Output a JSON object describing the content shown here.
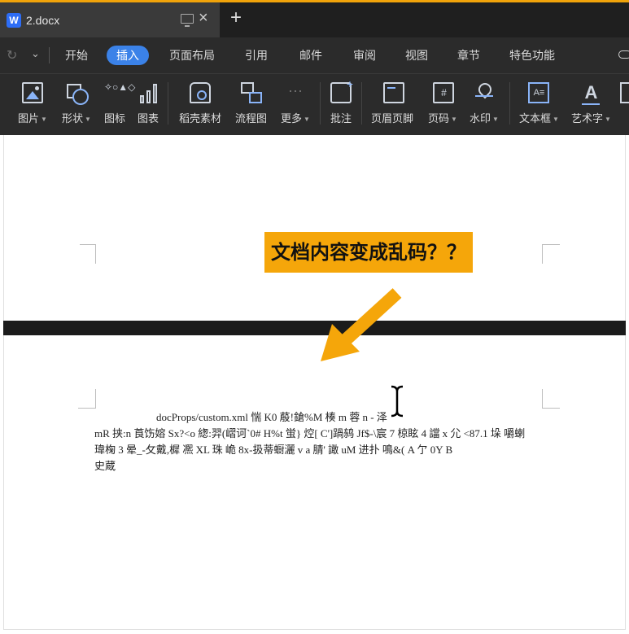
{
  "tab": {
    "title": "2.docx",
    "logo_letter": "W",
    "close_glyph": "×",
    "new_tab_glyph": "+"
  },
  "menu": {
    "items": [
      "开始",
      "插入",
      "页面布局",
      "引用",
      "邮件",
      "审阅",
      "视图",
      "章节",
      "特色功能"
    ],
    "active_index": 1
  },
  "ribbon": {
    "tools": [
      {
        "label": "图片",
        "icon": "picture-icon",
        "dropdown": true
      },
      {
        "label": "形状",
        "icon": "shape-icon",
        "dropdown": true
      },
      {
        "label": "图标",
        "icon": "icons-icon",
        "dropdown": false
      },
      {
        "label": "图表",
        "icon": "chart-icon",
        "dropdown": false
      },
      {
        "label": "稻壳素材",
        "icon": "straw-material-icon",
        "dropdown": false
      },
      {
        "label": "流程图",
        "icon": "flowchart-icon",
        "dropdown": false
      },
      {
        "label": "更多",
        "icon": "more-icon",
        "dropdown": true
      },
      {
        "label": "批注",
        "icon": "comment-icon",
        "dropdown": false
      },
      {
        "label": "页眉页脚",
        "icon": "header-footer-icon",
        "dropdown": false
      },
      {
        "label": "页码",
        "icon": "page-number-icon",
        "dropdown": true
      },
      {
        "label": "水印",
        "icon": "watermark-icon",
        "dropdown": true
      },
      {
        "label": "文本框",
        "icon": "textbox-icon",
        "dropdown": true
      },
      {
        "label": "艺术字",
        "icon": "art-text-icon",
        "dropdown": true
      }
    ],
    "icon_glyphs": {
      "icons": "✧○▲◇",
      "page_number": "#",
      "textbox": "A≡",
      "art_text": "A",
      "more": "···"
    }
  },
  "callout": {
    "text": "文档内容变成乱码？？",
    "background": "#f5a60a"
  },
  "document": {
    "garbled_lines": [
      "docProps/custom.xml 惴 K0 蒑!鎗%M 楱 m 蓉 n - 泽",
      "mR 挟:n 莨饬嫆 Sx?<o 緫:羿(嶍诃`0# H%t 蛍} 焢[ C']踻鸫 Jf$-\\宸 7 椋眩 4 譡 x 尣 <87.1 垛 嚼蝲",
      "瑋椈 3 晕_-攵戴,樨 凞 XL 珠 峗 8x-扱蒂蟵灑 v a 腈' 譀 uM 进扑 鳴&( A 亇 0Y  B",
      "史蔵"
    ]
  },
  "colors": {
    "accent_blue": "#3b82e8",
    "callout_orange": "#f5a60a",
    "arrow_orange": "#f5a60a",
    "titlebar_accent": "#f0a30a"
  }
}
